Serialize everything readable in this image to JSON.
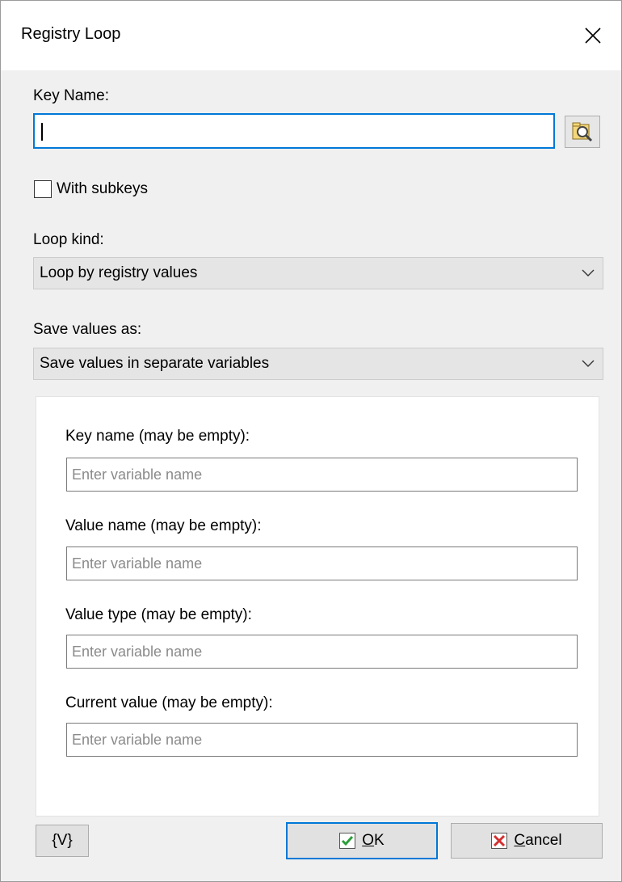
{
  "window": {
    "title": "Registry Loop"
  },
  "key_name": {
    "label": "Key Name:",
    "value": ""
  },
  "with_subkeys": {
    "label": "With subkeys",
    "checked": false
  },
  "loop_kind": {
    "label": "Loop kind:",
    "selected": "Loop by registry values"
  },
  "save_values": {
    "label": "Save values as:",
    "selected": "Save values in separate variables"
  },
  "fields": [
    {
      "label": "Key name (may be empty):",
      "placeholder": "Enter variable name"
    },
    {
      "label": "Value name (may be empty):",
      "placeholder": "Enter variable name"
    },
    {
      "label": "Value type (may be empty):",
      "placeholder": "Enter variable name"
    },
    {
      "label": "Current value (may be empty):",
      "placeholder": "Enter variable name"
    }
  ],
  "buttons": {
    "variables": "{V}",
    "ok_first": "O",
    "ok_rest": "K",
    "cancel_first": "C",
    "cancel_rest": "ancel"
  },
  "colors": {
    "accent": "#0078d7",
    "ok_check": "#2e9e3a",
    "cancel_x": "#d32f2f"
  }
}
